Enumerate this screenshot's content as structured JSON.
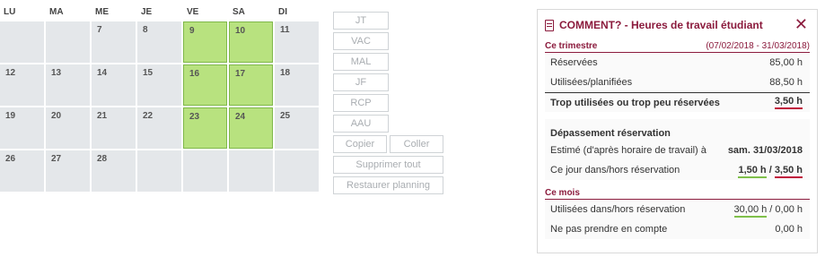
{
  "calendar": {
    "days_header": [
      "LU",
      "MA",
      "ME",
      "JE",
      "VE",
      "SA",
      "DI"
    ],
    "weeks": [
      [
        {
          "d": "",
          "g": false
        },
        {
          "d": "",
          "g": false
        },
        {
          "d": "7",
          "g": false
        },
        {
          "d": "8",
          "g": false
        },
        {
          "d": "9",
          "g": true
        },
        {
          "d": "10",
          "g": true
        },
        {
          "d": "11",
          "g": false
        }
      ],
      [
        {
          "d": "12",
          "g": false
        },
        {
          "d": "13",
          "g": false
        },
        {
          "d": "14",
          "g": false
        },
        {
          "d": "15",
          "g": false
        },
        {
          "d": "16",
          "g": true
        },
        {
          "d": "17",
          "g": true
        },
        {
          "d": "18",
          "g": false
        }
      ],
      [
        {
          "d": "19",
          "g": false
        },
        {
          "d": "20",
          "g": false
        },
        {
          "d": "21",
          "g": false
        },
        {
          "d": "22",
          "g": false
        },
        {
          "d": "23",
          "g": true
        },
        {
          "d": "24",
          "g": true
        },
        {
          "d": "25",
          "g": false
        }
      ],
      [
        {
          "d": "26",
          "g": false
        },
        {
          "d": "27",
          "g": false
        },
        {
          "d": "28",
          "g": false
        },
        {
          "d": "",
          "g": false
        },
        {
          "d": "",
          "g": false
        },
        {
          "d": "",
          "g": false
        },
        {
          "d": "",
          "g": false
        }
      ]
    ],
    "green_color": "#b8e27f"
  },
  "buttons": {
    "jt": "JT",
    "vac": "VAC",
    "mal": "MAL",
    "jf": "JF",
    "rcp": "RCP",
    "aau": "AAU",
    "copier": "Copier",
    "coller": "Coller",
    "supprimer": "Supprimer tout",
    "restaurer": "Restaurer planning"
  },
  "panel": {
    "title": "COMMENT? - Heures de travail étudiant",
    "close": "✕",
    "trimestre": {
      "title": "Ce trimestre",
      "range": "(07/02/2018 - 31/03/2018)",
      "reservees_label": "Réservées",
      "reservees_value": "85,00 h",
      "utilisees_label": "Utilisées/planifiées",
      "utilisees_value": "88,50 h",
      "trop_label": "Trop utilisées ou trop peu réservées",
      "trop_value": "3,50 h"
    },
    "depassement": {
      "title": "Dépassement réservation",
      "estime_label": "Estimé (d'après horaire de travail) à",
      "estime_value": "sam. 31/03/2018",
      "jour_label": "Ce jour dans/hors réservation",
      "jour_in": "1,50 h",
      "jour_sep": " / ",
      "jour_out": "3,50 h"
    },
    "mois": {
      "title": "Ce mois",
      "utilisees_label": "Utilisées dans/hors réservation",
      "utilisees_in": "30,00 h",
      "utilisees_sep": " / ",
      "utilisees_out": "0,00 h",
      "ignore_label": "Ne pas prendre en compte",
      "ignore_value": "0,00 h"
    },
    "accent": "#8b1b3d"
  }
}
